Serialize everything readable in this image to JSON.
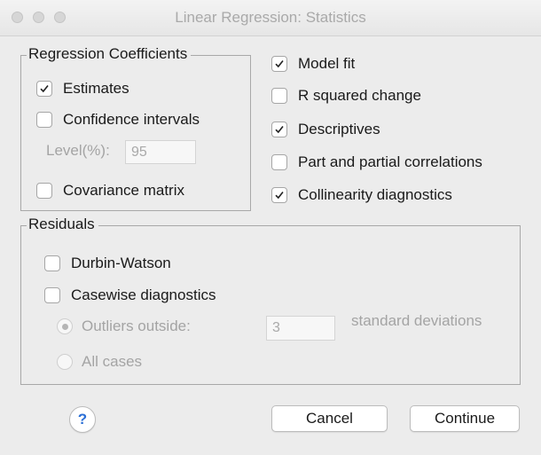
{
  "window": {
    "title": "Linear Regression: Statistics"
  },
  "regression_coefficients": {
    "legend": "Regression Coefficients",
    "estimates": {
      "label": "Estimates",
      "checked": true
    },
    "confidence_intervals": {
      "label": "Confidence intervals",
      "checked": false
    },
    "level_label": "Level(%):",
    "level_value": "95",
    "covariance_matrix": {
      "label": "Covariance matrix",
      "checked": false
    }
  },
  "right_options": {
    "model_fit": {
      "label": "Model fit",
      "checked": true
    },
    "r_squared_change": {
      "label": "R squared change",
      "checked": false
    },
    "descriptives": {
      "label": "Descriptives",
      "checked": true
    },
    "part_partial": {
      "label": "Part and partial correlations",
      "checked": false
    },
    "collinearity": {
      "label": "Collinearity diagnostics",
      "checked": true
    }
  },
  "residuals": {
    "legend": "Residuals",
    "durbin_watson": {
      "label": "Durbin-Watson",
      "checked": false
    },
    "casewise": {
      "label": "Casewise diagnostics",
      "checked": false
    },
    "outliers_outside": {
      "label": "Outliers outside:",
      "selected": true
    },
    "outliers_value": "3",
    "std_dev_label": "standard deviations",
    "all_cases": {
      "label": "All cases",
      "selected": false
    }
  },
  "buttons": {
    "help": "?",
    "cancel": "Cancel",
    "continue": "Continue"
  }
}
